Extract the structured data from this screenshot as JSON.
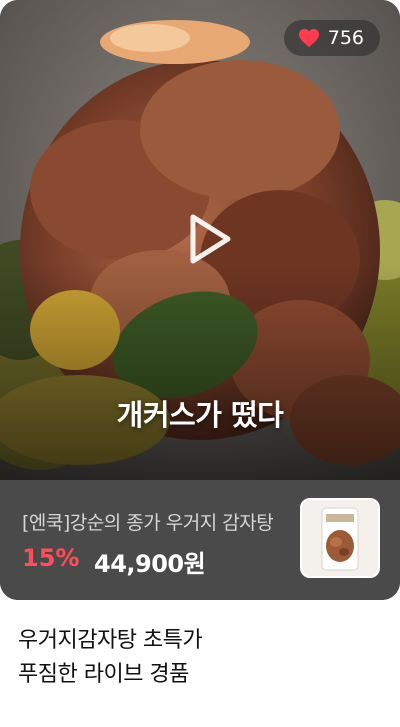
{
  "live": {
    "likes_count": "756",
    "overlay_title": "개커스가 떴다",
    "icons": {
      "likes": "heart-icon",
      "play": "play-icon"
    }
  },
  "product": {
    "name": "[엔쿡]강순의 종가 우거지 감자탕",
    "discount": "15%",
    "price": "44,900원"
  },
  "caption": {
    "line1": "우거지감자탕 초특가",
    "line2": "푸짐한 라이브 경품"
  },
  "colors": {
    "heart": "#ff3b4f",
    "discount": "#ff4d5a",
    "product_bar": "#4a4a4a"
  }
}
